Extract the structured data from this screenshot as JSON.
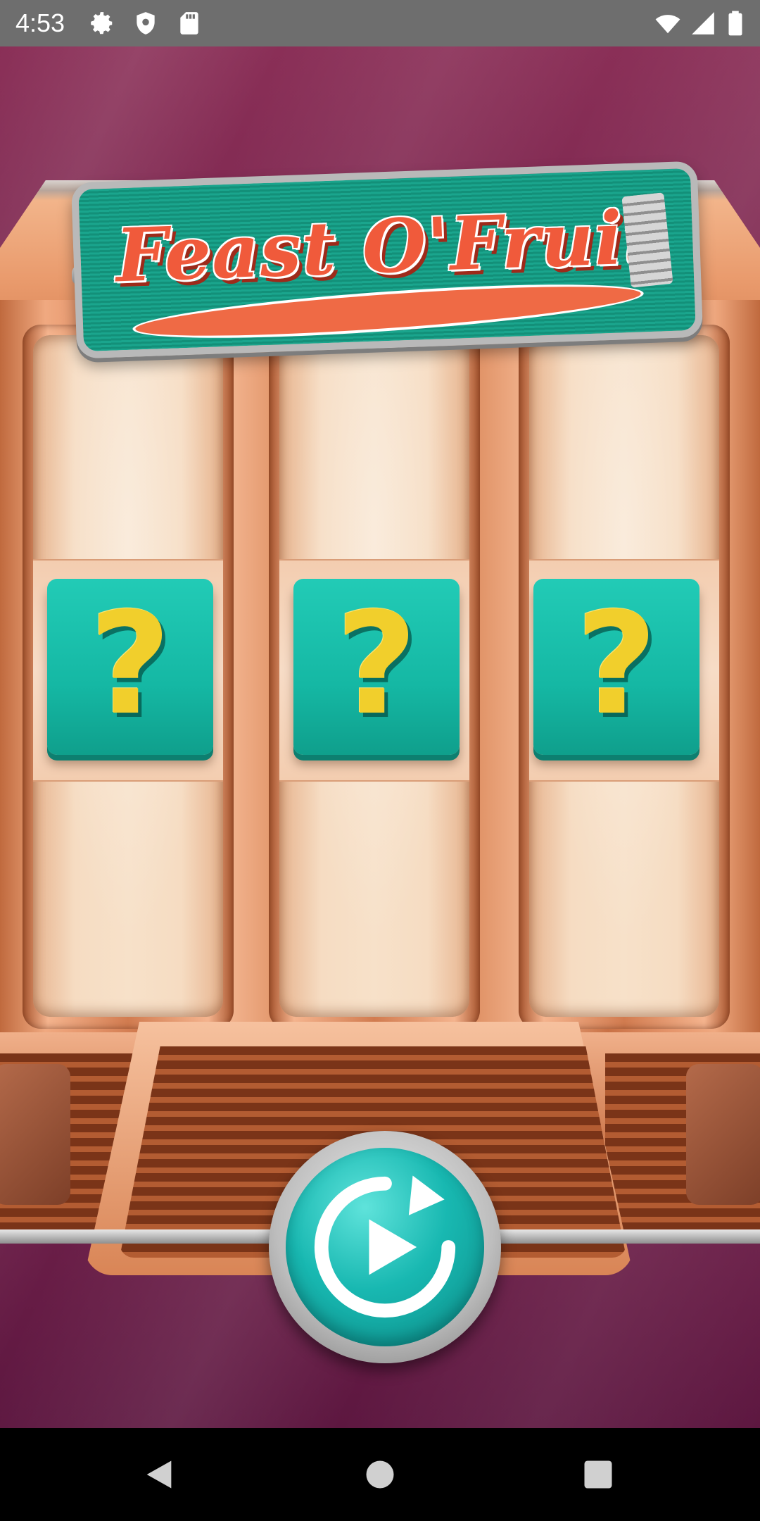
{
  "status_bar": {
    "time": "4:53",
    "icons": [
      "gear-icon",
      "shield-icon",
      "sd-card-icon",
      "wifi-icon",
      "signal-icon",
      "battery-icon"
    ]
  },
  "game": {
    "title": "Feast O'Fruit",
    "reels": [
      {
        "symbol": "?"
      },
      {
        "symbol": "?"
      },
      {
        "symbol": "?"
      }
    ],
    "spin_button": {
      "icon": "replay-play-icon"
    }
  },
  "nav_bar": {
    "buttons": [
      "back-icon",
      "home-icon",
      "recents-icon"
    ]
  },
  "colors": {
    "background": "#6d1f48",
    "tile": "#15b8a4",
    "question_mark": "#f1cf2c",
    "spin_button": "#18b8b1",
    "copper": "#d98556"
  }
}
